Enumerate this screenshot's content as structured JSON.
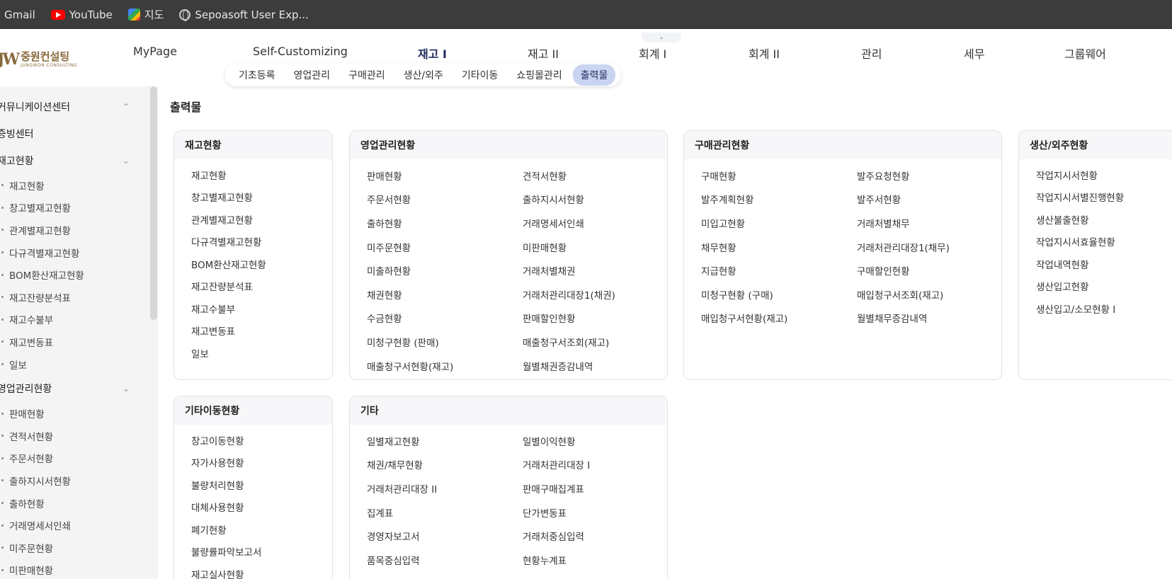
{
  "bookmarks": [
    {
      "label": "Gmail",
      "icon": "gmail-icon"
    },
    {
      "label": "YouTube",
      "icon": "youtube-icon"
    },
    {
      "label": "지도",
      "icon": "maps-icon"
    },
    {
      "label": "Sepoasoft User Exp...",
      "icon": "globe-icon"
    }
  ],
  "logo": {
    "name": "중원컨설팅",
    "sub": "JUNGWON CONSULTING"
  },
  "main_menu": [
    "MyPage",
    "Self-Customizing",
    "재고 I",
    "재고 II",
    "회계 I",
    "회계 II",
    "관리",
    "세무",
    "그룹웨어"
  ],
  "main_menu_active": "재고 I",
  "sub_menu": [
    "기초등록",
    "영업관리",
    "구매관리",
    "생산/외주",
    "기타이동",
    "쇼핑몰관리",
    "출력물"
  ],
  "sub_menu_active": "출력물",
  "sidebar": {
    "groups": [
      {
        "label": "커뮤니케이션센터",
        "state": "expanded-up",
        "items": []
      },
      {
        "label": "증빙센터",
        "state": "none",
        "items": []
      },
      {
        "label": "재고현황",
        "state": "expanded",
        "items": [
          "재고현황",
          "창고별재고현황",
          "관계별재고현황",
          "다규격별재고현황",
          "BOM환산재고현황",
          "재고잔량분석표",
          "재고수불부",
          "재고변동표",
          "일보"
        ]
      },
      {
        "label": "영업관리현황",
        "state": "expanded",
        "items": [
          "판매현황",
          "견적서현황",
          "주문서현황",
          "출하지시서현황",
          "출하현황",
          "거래명세서인쇄",
          "미주문현황",
          "미판매현황"
        ]
      }
    ]
  },
  "page_title": "출력물",
  "cards": {
    "inventory": {
      "title": "재고현황",
      "col1": [
        "재고현황",
        "창고별재고현황",
        "관계별재고현황",
        "다규격별재고현황",
        "BOM환산재고현황",
        "재고잔량분석표",
        "재고수불부",
        "재고변동표",
        "일보"
      ]
    },
    "sales": {
      "title": "영업관리현황",
      "col1": [
        "판매현황",
        "주문서현황",
        "출하현황",
        "미주문현황",
        "미출하현황",
        "채권현황",
        "수금현황",
        "미청구현황 (판매)",
        "매출청구서현황(재고)"
      ],
      "col2": [
        "견적서현황",
        "출하지시서현황",
        "거래명세서인쇄",
        "미판매현황",
        "거래처별채권",
        "거래처관리대장1(채권)",
        "판매할인현황",
        "매출청구서조회(재고)",
        "월별채권증감내역"
      ]
    },
    "purchase": {
      "title": "구매관리현황",
      "col1": [
        "구매현황",
        "발주계획현황",
        "미입고현황",
        "채무현황",
        "지급현황",
        "미청구현황 (구매)",
        "매입청구서현황(재고)"
      ],
      "col2": [
        "발주요청현황",
        "발주서현황",
        "거래처별채무",
        "거래처관리대장1(채무)",
        "구매할인현황",
        "매입청구서조회(재고)",
        "월별채무증감내역"
      ]
    },
    "production": {
      "title": "생산/외주현황",
      "col1": [
        "작업지시서현황",
        "작업지시서별진행현황",
        "생산불출현황",
        "작업지시서효율현황",
        "작업내역현황",
        "생산입고현황",
        "생산입고/소모현황 I"
      ]
    },
    "other_move": {
      "title": "기타이동현황",
      "col1": [
        "창고이동현황",
        "자가사용현황",
        "불량처리현황",
        "대체사용현황",
        "폐기현황",
        "불량률파악보고서",
        "재고실사현황"
      ]
    },
    "etc": {
      "title": "기타",
      "col1": [
        "일별재고현황",
        "채권/채무현황",
        "거래처관리대장 II",
        "집계표",
        "경영자보고서",
        "품목중심입력"
      ],
      "col2": [
        "일별이익현황",
        "거래처관리대장 I",
        "판매구매집계표",
        "단가변동표",
        "거래처중심입력",
        "현황누계표"
      ]
    }
  }
}
